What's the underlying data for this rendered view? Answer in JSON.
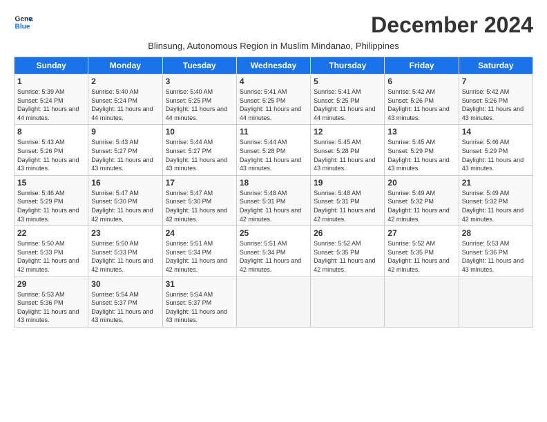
{
  "header": {
    "logo_line1": "General",
    "logo_line2": "Blue",
    "month": "December 2024",
    "subtitle": "Blinsung, Autonomous Region in Muslim Mindanao, Philippines"
  },
  "weekdays": [
    "Sunday",
    "Monday",
    "Tuesday",
    "Wednesday",
    "Thursday",
    "Friday",
    "Saturday"
  ],
  "weeks": [
    [
      {
        "day": "1",
        "sunrise": "5:39 AM",
        "sunset": "5:24 PM",
        "daylight": "11 hours and 44 minutes."
      },
      {
        "day": "2",
        "sunrise": "5:40 AM",
        "sunset": "5:24 PM",
        "daylight": "11 hours and 44 minutes."
      },
      {
        "day": "3",
        "sunrise": "5:40 AM",
        "sunset": "5:25 PM",
        "daylight": "11 hours and 44 minutes."
      },
      {
        "day": "4",
        "sunrise": "5:41 AM",
        "sunset": "5:25 PM",
        "daylight": "11 hours and 44 minutes."
      },
      {
        "day": "5",
        "sunrise": "5:41 AM",
        "sunset": "5:25 PM",
        "daylight": "11 hours and 44 minutes."
      },
      {
        "day": "6",
        "sunrise": "5:42 AM",
        "sunset": "5:26 PM",
        "daylight": "11 hours and 43 minutes."
      },
      {
        "day": "7",
        "sunrise": "5:42 AM",
        "sunset": "5:26 PM",
        "daylight": "11 hours and 43 minutes."
      }
    ],
    [
      {
        "day": "8",
        "sunrise": "5:43 AM",
        "sunset": "5:26 PM",
        "daylight": "11 hours and 43 minutes."
      },
      {
        "day": "9",
        "sunrise": "5:43 AM",
        "sunset": "5:27 PM",
        "daylight": "11 hours and 43 minutes."
      },
      {
        "day": "10",
        "sunrise": "5:44 AM",
        "sunset": "5:27 PM",
        "daylight": "11 hours and 43 minutes."
      },
      {
        "day": "11",
        "sunrise": "5:44 AM",
        "sunset": "5:28 PM",
        "daylight": "11 hours and 43 minutes."
      },
      {
        "day": "12",
        "sunrise": "5:45 AM",
        "sunset": "5:28 PM",
        "daylight": "11 hours and 43 minutes."
      },
      {
        "day": "13",
        "sunrise": "5:45 AM",
        "sunset": "5:29 PM",
        "daylight": "11 hours and 43 minutes."
      },
      {
        "day": "14",
        "sunrise": "5:46 AM",
        "sunset": "5:29 PM",
        "daylight": "11 hours and 43 minutes."
      }
    ],
    [
      {
        "day": "15",
        "sunrise": "5:46 AM",
        "sunset": "5:29 PM",
        "daylight": "11 hours and 43 minutes."
      },
      {
        "day": "16",
        "sunrise": "5:47 AM",
        "sunset": "5:30 PM",
        "daylight": "11 hours and 42 minutes."
      },
      {
        "day": "17",
        "sunrise": "5:47 AM",
        "sunset": "5:30 PM",
        "daylight": "11 hours and 42 minutes."
      },
      {
        "day": "18",
        "sunrise": "5:48 AM",
        "sunset": "5:31 PM",
        "daylight": "11 hours and 42 minutes."
      },
      {
        "day": "19",
        "sunrise": "5:48 AM",
        "sunset": "5:31 PM",
        "daylight": "11 hours and 42 minutes."
      },
      {
        "day": "20",
        "sunrise": "5:49 AM",
        "sunset": "5:32 PM",
        "daylight": "11 hours and 42 minutes."
      },
      {
        "day": "21",
        "sunrise": "5:49 AM",
        "sunset": "5:32 PM",
        "daylight": "11 hours and 42 minutes."
      }
    ],
    [
      {
        "day": "22",
        "sunrise": "5:50 AM",
        "sunset": "5:33 PM",
        "daylight": "11 hours and 42 minutes."
      },
      {
        "day": "23",
        "sunrise": "5:50 AM",
        "sunset": "5:33 PM",
        "daylight": "11 hours and 42 minutes."
      },
      {
        "day": "24",
        "sunrise": "5:51 AM",
        "sunset": "5:34 PM",
        "daylight": "11 hours and 42 minutes."
      },
      {
        "day": "25",
        "sunrise": "5:51 AM",
        "sunset": "5:34 PM",
        "daylight": "11 hours and 42 minutes."
      },
      {
        "day": "26",
        "sunrise": "5:52 AM",
        "sunset": "5:35 PM",
        "daylight": "11 hours and 42 minutes."
      },
      {
        "day": "27",
        "sunrise": "5:52 AM",
        "sunset": "5:35 PM",
        "daylight": "11 hours and 42 minutes."
      },
      {
        "day": "28",
        "sunrise": "5:53 AM",
        "sunset": "5:36 PM",
        "daylight": "11 hours and 43 minutes."
      }
    ],
    [
      {
        "day": "29",
        "sunrise": "5:53 AM",
        "sunset": "5:36 PM",
        "daylight": "11 hours and 43 minutes."
      },
      {
        "day": "30",
        "sunrise": "5:54 AM",
        "sunset": "5:37 PM",
        "daylight": "11 hours and 43 minutes."
      },
      {
        "day": "31",
        "sunrise": "5:54 AM",
        "sunset": "5:37 PM",
        "daylight": "11 hours and 43 minutes."
      },
      null,
      null,
      null,
      null
    ]
  ]
}
